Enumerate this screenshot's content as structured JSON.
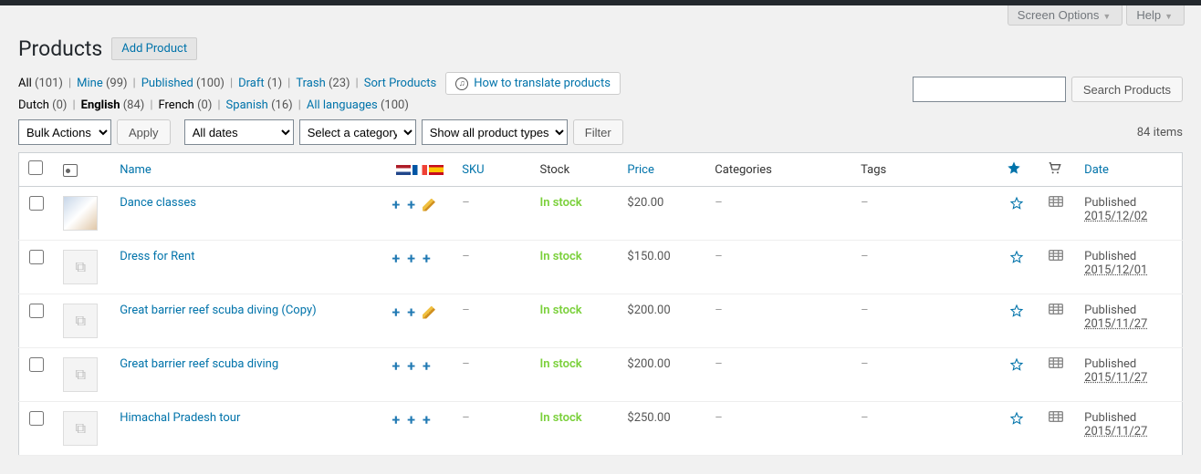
{
  "screen_meta": {
    "screen_options": "Screen Options",
    "help": "Help"
  },
  "heading": "Products",
  "add_button": "Add Product",
  "status_filters": [
    {
      "label": "All",
      "count": "(101)",
      "current": true,
      "link": false
    },
    {
      "label": "Mine",
      "count": "(99)",
      "link": true
    },
    {
      "label": "Published",
      "count": "(100)",
      "link": true
    },
    {
      "label": "Draft",
      "count": "(1)",
      "link": true
    },
    {
      "label": "Trash",
      "count": "(23)",
      "link": true
    },
    {
      "label": "Sort Products",
      "count": "",
      "link": true
    }
  ],
  "translate_button": "How to translate products",
  "lang_filters": [
    {
      "label": "Dutch",
      "count": "(0)",
      "link": false
    },
    {
      "label": "English",
      "count": "(84)",
      "link": false,
      "bold": true
    },
    {
      "label": "French",
      "count": "(0)",
      "link": false
    },
    {
      "label": "Spanish",
      "count": "(16)",
      "link": true
    },
    {
      "label": "All languages",
      "count": "(100)",
      "link": true
    }
  ],
  "bulk": {
    "label": "Bulk Actions",
    "apply": "Apply"
  },
  "filters": {
    "dates": "All dates",
    "category": "Select a category",
    "type": "Show all product types",
    "filter": "Filter"
  },
  "items_count": "84 items",
  "search": {
    "placeholder": "",
    "button": "Search Products"
  },
  "columns": {
    "name": "Name",
    "sku": "SKU",
    "stock": "Stock",
    "price": "Price",
    "categories": "Categories",
    "tags": "Tags",
    "date": "Date"
  },
  "rows": [
    {
      "thumb": "img",
      "name": "Dance classes",
      "lang": [
        "plus",
        "plus",
        "pencil"
      ],
      "sku": "–",
      "stock": "In stock",
      "price": "$20.00",
      "categories": "–",
      "tags": "–",
      "date_status": "Published",
      "date": "2015/12/02"
    },
    {
      "thumb": "placeholder",
      "name": "Dress for Rent",
      "lang": [
        "plus",
        "plus",
        "plus"
      ],
      "sku": "–",
      "stock": "In stock",
      "price": "$150.00",
      "categories": "–",
      "tags": "–",
      "date_status": "Published",
      "date": "2015/12/01"
    },
    {
      "thumb": "placeholder",
      "name": "Great barrier reef scuba diving (Copy)",
      "lang": [
        "plus",
        "plus",
        "pencil"
      ],
      "sku": "–",
      "stock": "In stock",
      "price": "$200.00",
      "categories": "–",
      "tags": "–",
      "date_status": "Published",
      "date": "2015/11/27"
    },
    {
      "thumb": "placeholder",
      "name": "Great barrier reef scuba diving",
      "lang": [
        "plus",
        "plus",
        "plus"
      ],
      "sku": "–",
      "stock": "In stock",
      "price": "$200.00",
      "categories": "–",
      "tags": "–",
      "date_status": "Published",
      "date": "2015/11/27"
    },
    {
      "thumb": "placeholder",
      "name": "Himachal Pradesh tour",
      "lang": [
        "plus",
        "plus",
        "plus"
      ],
      "sku": "–",
      "stock": "In stock",
      "price": "$250.00",
      "categories": "–",
      "tags": "–",
      "date_status": "Published",
      "date": "2015/11/27"
    }
  ]
}
